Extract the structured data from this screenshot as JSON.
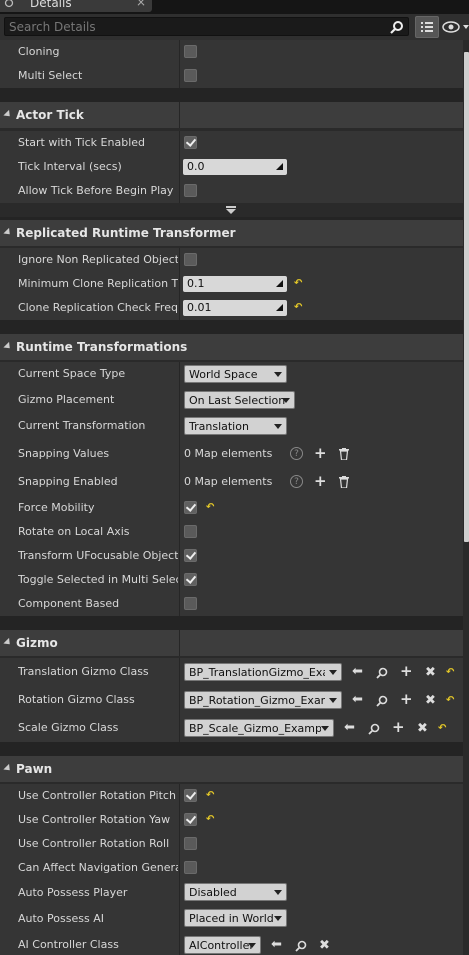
{
  "tab": {
    "title": "Details",
    "close": "×"
  },
  "search": {
    "placeholder": "Search Details"
  },
  "sections": {
    "misc": {
      "cloning": "Cloning",
      "multi_select": "Multi Select"
    },
    "actor_tick": {
      "title": "Actor Tick",
      "start_with_tick": "Start with Tick Enabled",
      "tick_interval": "Tick Interval (secs)",
      "tick_interval_value": "0.0",
      "allow_tick": "Allow Tick Before Begin Play"
    },
    "replicated": {
      "title": "Replicated Runtime Transformer",
      "ignore_non_replicated": "Ignore Non Replicated Objects",
      "min_clone_rep_time": "Minimum Clone Replication Time",
      "min_clone_rep_value": "0.1",
      "clone_rep_check_freq": "Clone Replication Check Frequency",
      "clone_rep_check_value": "0.01"
    },
    "runtime": {
      "title": "Runtime Transformations",
      "current_space_type": "Current Space Type",
      "current_space_value": "World Space",
      "gizmo_placement": "Gizmo Placement",
      "gizmo_placement_value": "On Last Selection",
      "current_transformation": "Current Transformation",
      "current_transformation_value": "Translation",
      "snapping_values": "Snapping Values",
      "snapping_values_count": "0 Map elements",
      "snapping_enabled": "Snapping Enabled",
      "snapping_enabled_count": "0 Map elements",
      "force_mobility": "Force Mobility",
      "rotate_local": "Rotate on Local Axis",
      "transform_ufocusable": "Transform UFocusable Objects",
      "toggle_selected": "Toggle Selected in Multi Selection",
      "component_based": "Component Based"
    },
    "gizmo": {
      "title": "Gizmo",
      "translation_class": "Translation Gizmo Class",
      "translation_value": "BP_TranslationGizmo_Example",
      "rotation_class": "Rotation Gizmo Class",
      "rotation_value": "BP_Rotation_Gizmo_Example",
      "scale_class": "Scale Gizmo Class",
      "scale_value": "BP_Scale_Gizmo_Example"
    },
    "pawn": {
      "title": "Pawn",
      "use_rot_pitch": "Use Controller Rotation Pitch",
      "use_rot_yaw": "Use Controller Rotation Yaw",
      "use_rot_roll": "Use Controller Rotation Roll",
      "can_affect_nav": "Can Affect Navigation Generation",
      "auto_possess_player": "Auto Possess Player",
      "auto_possess_player_value": "Disabled",
      "auto_possess_ai": "Auto Possess AI",
      "auto_possess_ai_value": "Placed in World",
      "ai_controller_class": "AI Controller Class",
      "ai_controller_value": "AIController"
    }
  },
  "glyphs": {
    "plus": "+",
    "help": "?",
    "reset": "↶",
    "arrow_left": "⬅",
    "browse": "⚲",
    "clear": "✖"
  }
}
